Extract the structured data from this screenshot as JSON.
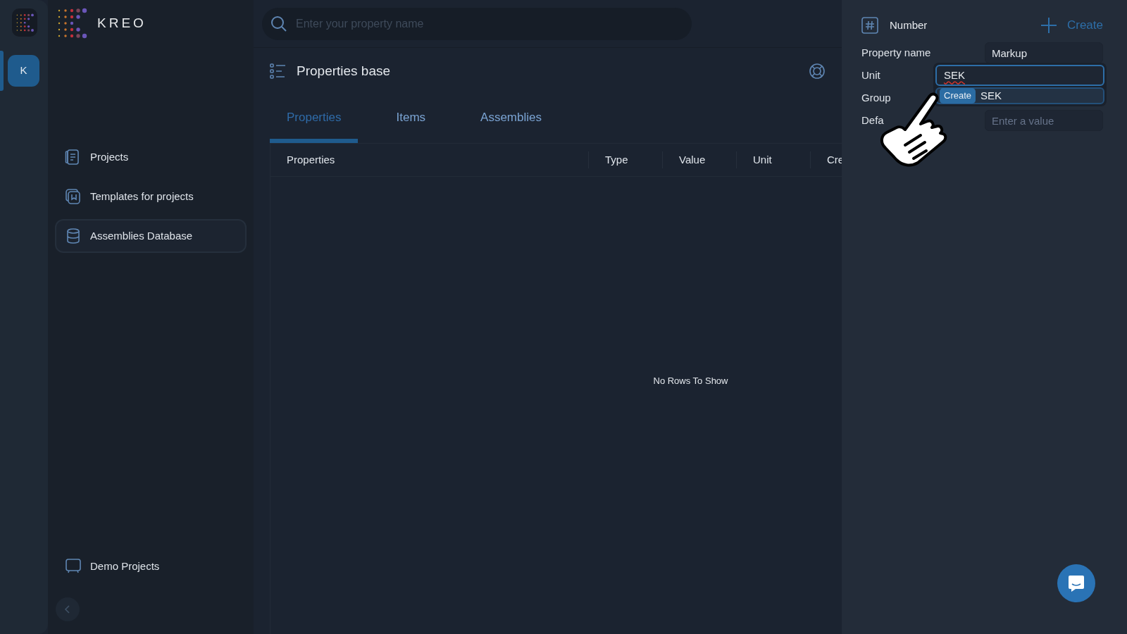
{
  "rail": {
    "avatar": "K",
    "avatar_selected": true
  },
  "brand": {
    "name": "KREO"
  },
  "search": {
    "placeholder": "Enter your property name"
  },
  "sidebar": {
    "items": [
      {
        "label": "Projects",
        "kind": "document",
        "selected": false
      },
      {
        "label": "Templates for projects",
        "kind": "template",
        "selected": false
      },
      {
        "label": "Assemblies Database",
        "kind": "database",
        "selected": true
      }
    ],
    "footer": {
      "label": "Demo Projects",
      "kind": "screen"
    }
  },
  "page": {
    "title": "Properties base",
    "tabs": [
      {
        "label": "Properties",
        "selected": true
      },
      {
        "label": "Items",
        "selected": false
      },
      {
        "label": "Assemblies",
        "selected": false
      }
    ],
    "table": {
      "columns": [
        "Properties",
        "Type",
        "Value",
        "Unit",
        "Cre"
      ],
      "empty_message": "No Rows To Show"
    }
  },
  "panel": {
    "type_label": "Number",
    "create_label": "Create",
    "fields": [
      {
        "label": "Property name",
        "kind": "input",
        "value": "Markup"
      },
      {
        "label": "Unit",
        "kind": "combo",
        "value": "SEK",
        "focused": true,
        "misspelled": true,
        "dropdown": {
          "badge": "Create",
          "option": "SEK"
        }
      },
      {
        "label": "Group",
        "kind": "covered"
      },
      {
        "label": "Defa",
        "kind": "input",
        "placeholder": "Enter a value"
      }
    ]
  }
}
